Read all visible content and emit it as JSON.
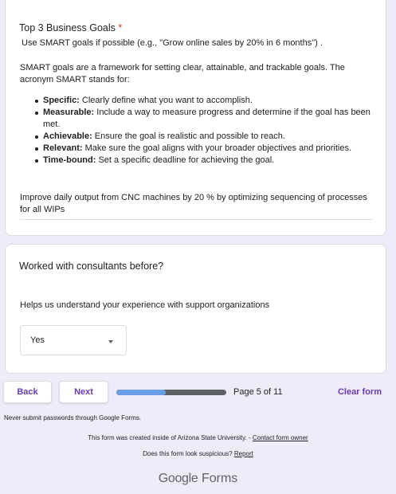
{
  "question1": {
    "title": "Top 3 Business Goals",
    "required_mark": "*",
    "hint": "Use SMART goals if possible (e.g., \"Grow online sales by 20% in 6 months\")  .",
    "intro": "SMART goals are a framework for setting clear, attainable, and trackable goals. The acronym SMART stands for:",
    "items": [
      {
        "term": "Specific:",
        "text": " Clearly define what you want to accomplish."
      },
      {
        "term": "Measurable:",
        "text": " Include a way to measure progress and determine if the goal has been met."
      },
      {
        "term": "Achievable:",
        "text": " Ensure the goal is realistic and possible to reach."
      },
      {
        "term": "Relevant:",
        "text": " Make sure the goal aligns with your broader objectives and priorities."
      },
      {
        "term": "Time-bound:",
        "text": " Set a specific deadline for achieving the goal."
      }
    ],
    "answer": "Improve daily output from CNC machines by 20 % by optimizing sequencing of processes for all WIPs"
  },
  "question2": {
    "title": "Worked with consultants before?",
    "description": "Helps us understand your experience with support organizations",
    "selected": "Yes"
  },
  "nav": {
    "back_label": "Back",
    "next_label": "Next",
    "progress_fraction": 0.45,
    "page_indicator": "Page 5 of 11",
    "clear_label": "Clear form"
  },
  "footer": {
    "password_warning": "Never submit passwords through Google Forms.",
    "created_text": "This form was created inside of Arizona State University. - ",
    "contact_link": "Contact form owner",
    "suspicious_text": "Does this form look suspicious? ",
    "report_link": "Report",
    "logo_google": "Google",
    "logo_forms": "Forms"
  },
  "colors": {
    "accent": "#673ab7",
    "background": "#efebf8",
    "progress_fill": "#6ba0e8",
    "progress_track": "#5f6368",
    "required": "#d93025"
  }
}
